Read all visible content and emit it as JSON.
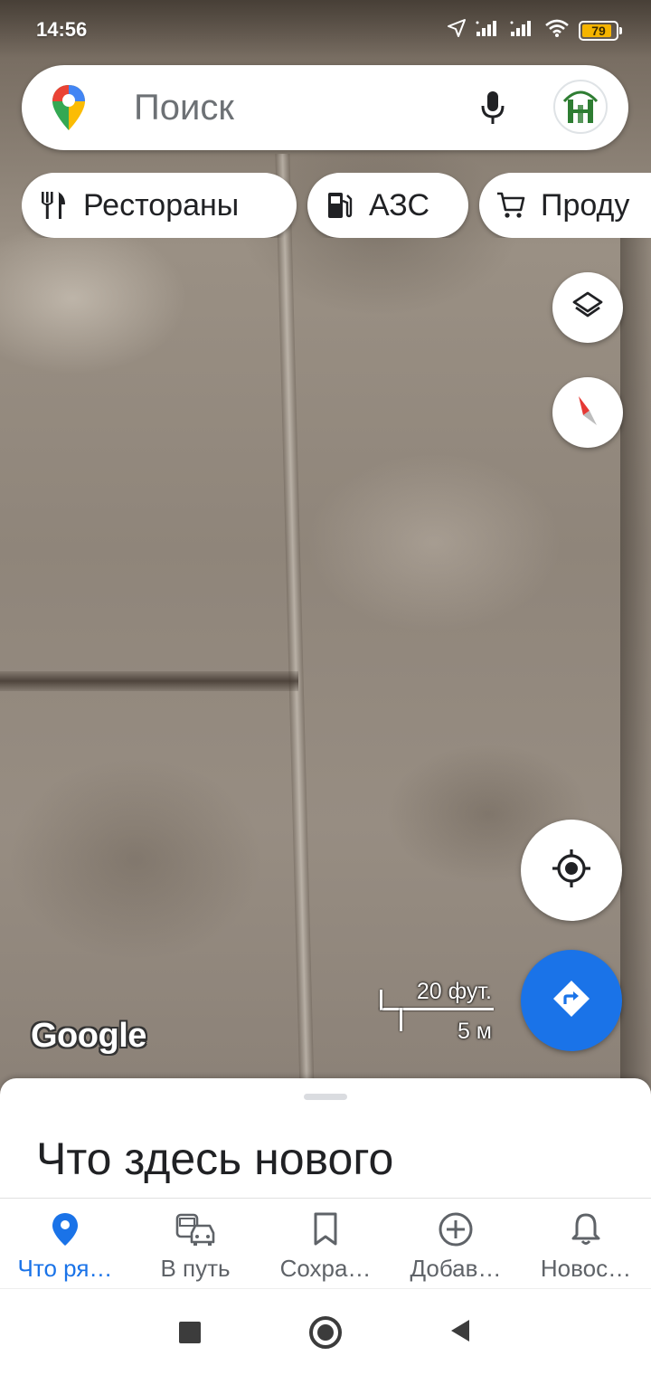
{
  "status_bar": {
    "time": "14:56",
    "battery_percent": "79",
    "icons": [
      "location-arrow-icon",
      "signal-icon",
      "signal-icon",
      "wifi-icon",
      "battery-icon"
    ]
  },
  "search": {
    "placeholder": "Поиск",
    "icons": [
      "google-maps-pin-icon",
      "mic-icon",
      "avatar"
    ]
  },
  "chips": [
    {
      "label": "Рестораны",
      "icon": "restaurant-icon"
    },
    {
      "label": "АЗС",
      "icon": "gas-station-icon"
    },
    {
      "label": "Проду",
      "icon": "shopping-cart-icon"
    }
  ],
  "map": {
    "logo": "Google",
    "scale_imperial": "20 фут.",
    "scale_metric": "5 м",
    "buttons": [
      "layers-icon",
      "compass-icon",
      "my-location-icon",
      "directions-icon"
    ]
  },
  "sheet": {
    "title": "Что здесь нового"
  },
  "bottom_nav": [
    {
      "label": "Что ря…",
      "icon": "explore-pin-icon",
      "active": true
    },
    {
      "label": "В путь",
      "icon": "commute-icon",
      "active": false
    },
    {
      "label": "Сохра…",
      "icon": "bookmark-icon",
      "active": false
    },
    {
      "label": "Добав…",
      "icon": "add-circle-icon",
      "active": false
    },
    {
      "label": "Новос…",
      "icon": "bell-icon",
      "active": false
    }
  ],
  "colors": {
    "accent": "#1a73e8",
    "battery": "#f5b400",
    "text_primary": "#202124",
    "text_secondary": "#5f6368"
  }
}
